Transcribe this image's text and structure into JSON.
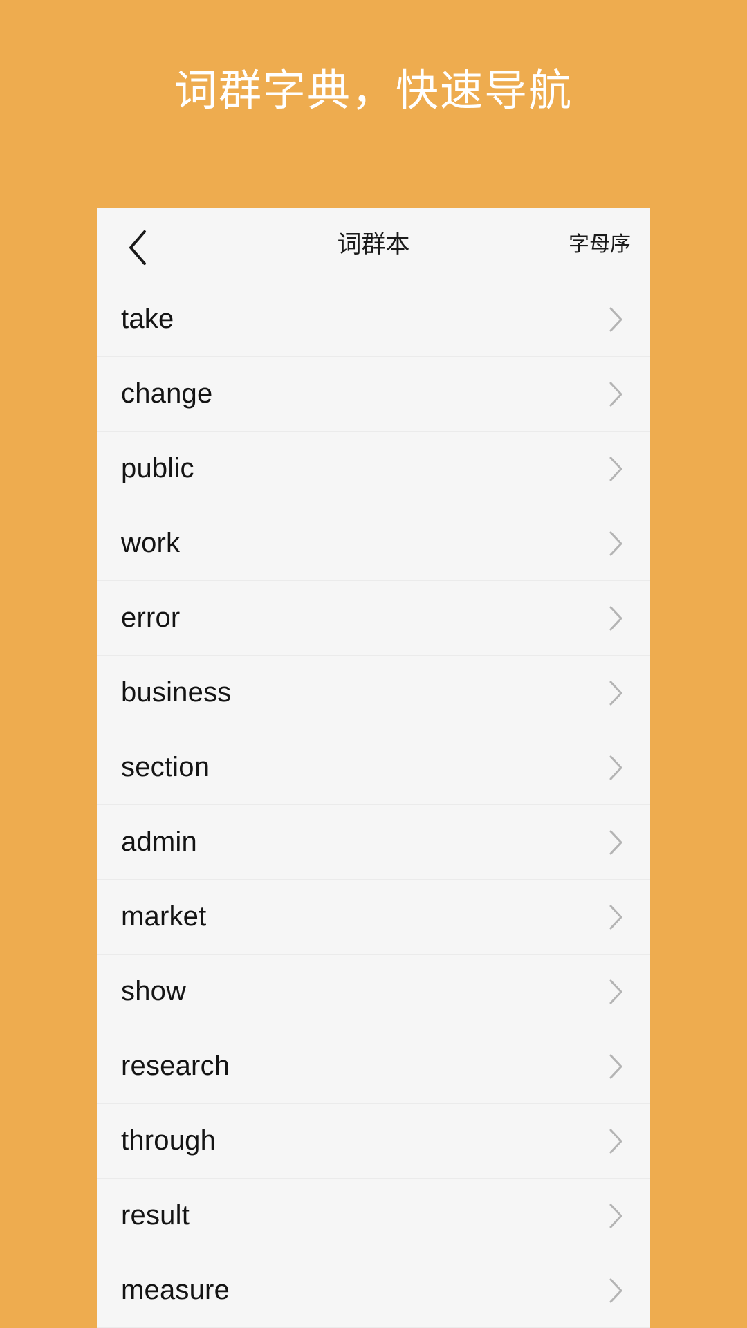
{
  "page": {
    "headline": "词群字典，快速导航",
    "background_color": "#eeac4f",
    "card_color": "#f6f6f6",
    "headline_color": "#ffffff"
  },
  "navbar": {
    "back_icon": "chevron-left-icon",
    "title": "词群本",
    "action_label": "字母序"
  },
  "list": {
    "row_chevron_icon": "chevron-right-icon",
    "items": [
      {
        "word": "take"
      },
      {
        "word": "change"
      },
      {
        "word": "public"
      },
      {
        "word": "work"
      },
      {
        "word": "error"
      },
      {
        "word": "business"
      },
      {
        "word": "section"
      },
      {
        "word": "admin"
      },
      {
        "word": "market"
      },
      {
        "word": "show"
      },
      {
        "word": "research"
      },
      {
        "word": "through"
      },
      {
        "word": "result"
      },
      {
        "word": "measure"
      }
    ]
  }
}
